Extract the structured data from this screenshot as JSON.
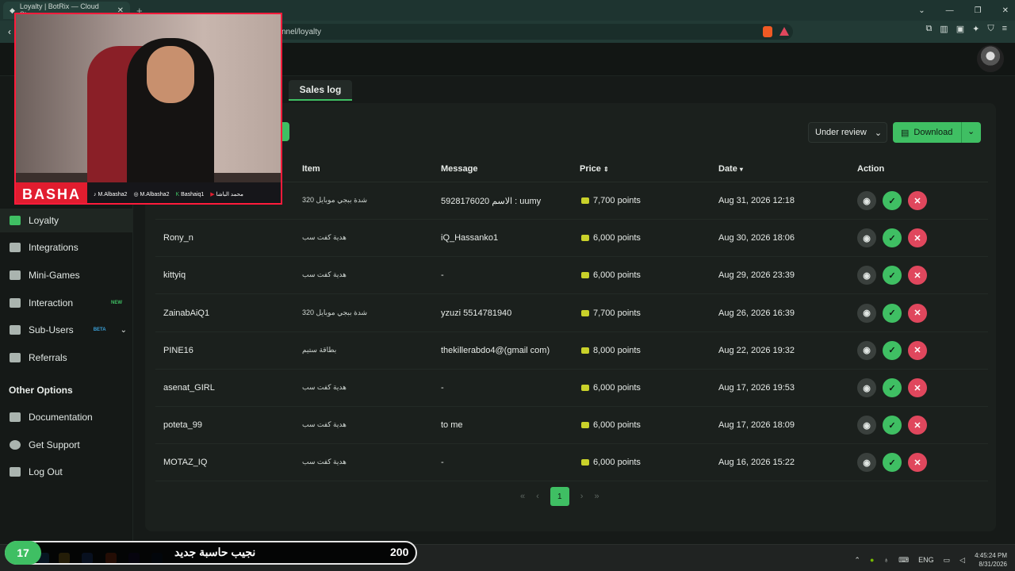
{
  "browser": {
    "tab_title": "Loyalty | BotRix — Cloud Stream",
    "url_fragment": "nnel/loyalty"
  },
  "sidebar": {
    "items": [
      {
        "label": "Loyalty",
        "icon": "trophy-icon",
        "active": true
      },
      {
        "label": "Integrations",
        "icon": "plug-icon"
      },
      {
        "label": "Mini-Games",
        "icon": "gamepad-icon"
      },
      {
        "label": "Interaction",
        "icon": "music-icon",
        "badge": "NEW"
      },
      {
        "label": "Sub-Users",
        "icon": "users-icon",
        "badge": "BETA"
      },
      {
        "label": "Referrals",
        "icon": "people-icon"
      }
    ],
    "other_heading": "Other Options",
    "other_items": [
      {
        "label": "Documentation",
        "icon": "document-icon"
      },
      {
        "label": "Get Support",
        "icon": "help-icon"
      },
      {
        "label": "Log Out",
        "icon": "logout-icon"
      }
    ]
  },
  "tabs": {
    "sales_log": "Sales log"
  },
  "filters": {
    "status": "Under review",
    "download": "Download"
  },
  "table": {
    "headers": {
      "item": "Item",
      "message": "Message",
      "price": "Price",
      "date": "Date",
      "action": "Action"
    },
    "rows": [
      {
        "user": "",
        "item": "شدة ببجي موبايل 320",
        "message": "5928176020 الاسم : uumy",
        "price": "7,700 points",
        "date": "Aug 31, 2026 12:18"
      },
      {
        "user": "Rony_n",
        "item": "هدية كفت سب",
        "message": "iQ_Hassanko1",
        "price": "6,000 points",
        "date": "Aug 30, 2026 18:06"
      },
      {
        "user": "kittyiq",
        "item": "هدية كفت سب",
        "message": "-",
        "price": "6,000 points",
        "date": "Aug 29, 2026 23:39"
      },
      {
        "user": "ZainabAiQ1",
        "item": "شدة ببجي موبايل 320",
        "message": "yzuzi 5514781940",
        "price": "7,700 points",
        "date": "Aug 26, 2026 16:39"
      },
      {
        "user": "PINE16",
        "item": "بطاقة ستيم",
        "message": "thekillerabdo4@(gmail com)",
        "price": "8,000 points",
        "date": "Aug 22, 2026 19:32"
      },
      {
        "user": "asenat_GIRL",
        "item": "هدية كفت سب",
        "message": "-",
        "price": "6,000 points",
        "date": "Aug 17, 2026 19:53"
      },
      {
        "user": "poteta_99",
        "item": "هدية كفت سب",
        "message": "to me",
        "price": "6,000 points",
        "date": "Aug 17, 2026 18:09"
      },
      {
        "user": "MOTAZ_IQ",
        "item": "هدية كفت سب",
        "message": "-",
        "price": "6,000 points",
        "date": "Aug 16, 2026 15:22"
      }
    ]
  },
  "pagination": {
    "current": "1"
  },
  "webcam": {
    "brand": "BASHA",
    "socials": [
      "M.Albasha2",
      "M.Albasha2",
      "Bashaiq1",
      "محمد الباشا"
    ]
  },
  "overlay": {
    "count": "17",
    "text": "نجيب حاسبة جديد",
    "score": "200"
  },
  "taskbar": {
    "lang": "ENG",
    "time": "4:45:24 PM",
    "date": "8/31/2026"
  },
  "colors": {
    "accent": "#3fbf63",
    "danger": "#e0475d",
    "cam_border": "#ff1b3b"
  }
}
